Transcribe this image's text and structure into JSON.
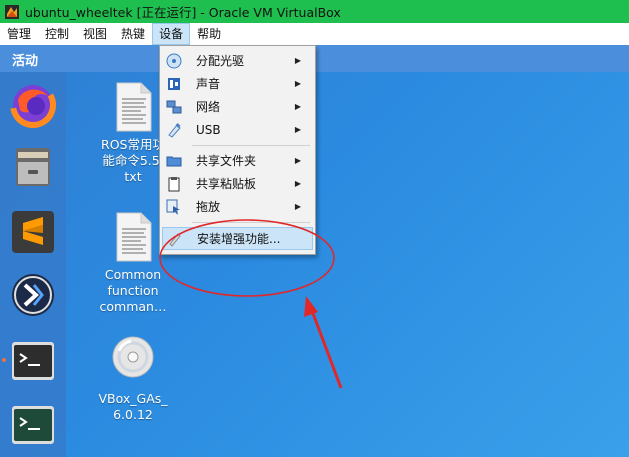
{
  "window": {
    "title": "ubuntu_wheeltek [正在运行] - Oracle VM VirtualBox"
  },
  "menubar": {
    "items": [
      "管理",
      "控制",
      "视图",
      "热键",
      "设备",
      "帮助"
    ],
    "active_index": 4
  },
  "guest": {
    "activities_label": "活动",
    "dock": [
      {
        "name": "firefox-icon"
      },
      {
        "name": "file-cabinet-icon"
      },
      {
        "name": "sublime-text-icon"
      },
      {
        "name": "kde-connect-icon"
      },
      {
        "name": "terminal-icon",
        "running": true
      },
      {
        "name": "terminal-icon"
      }
    ],
    "desktop_files": [
      {
        "label": "ROS常用功\n能命令5.5.\ntxt",
        "icon": "text-file-icon"
      },
      {
        "label": "Common\nfunction\ncomman…",
        "icon": "text-file-icon"
      },
      {
        "label": "VBox_GAs_\n6.0.12",
        "icon": "optical-disc-icon"
      }
    ]
  },
  "devices_menu": {
    "items": [
      {
        "label": "分配光驱",
        "icon": "optical-drive-icon",
        "submenu": true
      },
      {
        "label": "声音",
        "icon": "audio-icon",
        "submenu": true
      },
      {
        "label": "网络",
        "icon": "network-icon",
        "submenu": true
      },
      {
        "label": "USB",
        "icon": "usb-icon",
        "submenu": true
      },
      {
        "label": "共享文件夹",
        "icon": "shared-folder-icon",
        "submenu": true
      },
      {
        "label": "共享粘贴板",
        "icon": "clipboard-icon",
        "submenu": true
      },
      {
        "label": "拖放",
        "icon": "drag-drop-icon",
        "submenu": true
      },
      {
        "label": "安装增强功能...",
        "icon": "guest-additions-icon",
        "submenu": false,
        "highlighted": true
      }
    ]
  },
  "colors": {
    "titlebar": "#1fbf4f",
    "annotation": "#e0282a",
    "menu_highlight": "#cce4f7"
  }
}
